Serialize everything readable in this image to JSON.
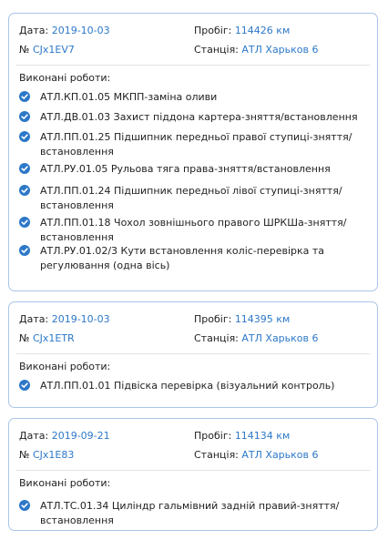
{
  "labels": {
    "date": "Дата:",
    "mileage": "Пробіг:",
    "number": "№",
    "station": "Станція:",
    "works": "Виконані роботи:"
  },
  "cards": [
    {
      "date": "2019-10-03",
      "mileage": "114426 км",
      "number": "CJx1EV7",
      "station": "АТЛ Харьков 6",
      "works": [
        "АТЛ.КП.01.05 МКПП-заміна оливи",
        "АТЛ.ДВ.01.03 Захист піддона картера-зняття/встановлення",
        "АТЛ.ПП.01.25 Підшипник передньої правої ступиці-зняття/встановлення",
        "АТЛ.РУ.01.05 Рульова тяга права-зняття/встановлення",
        "АТЛ.ПП.01.24 Підшипник передньої лівої ступиці-зняття/встановлення",
        "АТЛ.ПП.01.18 Чохол зовнішнього правого ШРКШа-зняття/встановлення",
        "АТЛ.РУ.01.02/3 Кути встановлення коліс-перевірка та регулювання (одна вісь)"
      ]
    },
    {
      "date": "2019-10-03",
      "mileage": "114395 км",
      "number": "CJx1ETR",
      "station": "АТЛ Харьков 6",
      "works": [
        "АТЛ.ПП.01.01 Підвіска перевірка (візуальний контроль)"
      ]
    },
    {
      "date": "2019-09-21",
      "mileage": "114134 км",
      "number": "CJx1E83",
      "station": "АТЛ Харьков 6",
      "works": [
        "АТЛ.ТС.01.34 Циліндр гальмівний задній правий-зняття/встановлення"
      ]
    }
  ]
}
